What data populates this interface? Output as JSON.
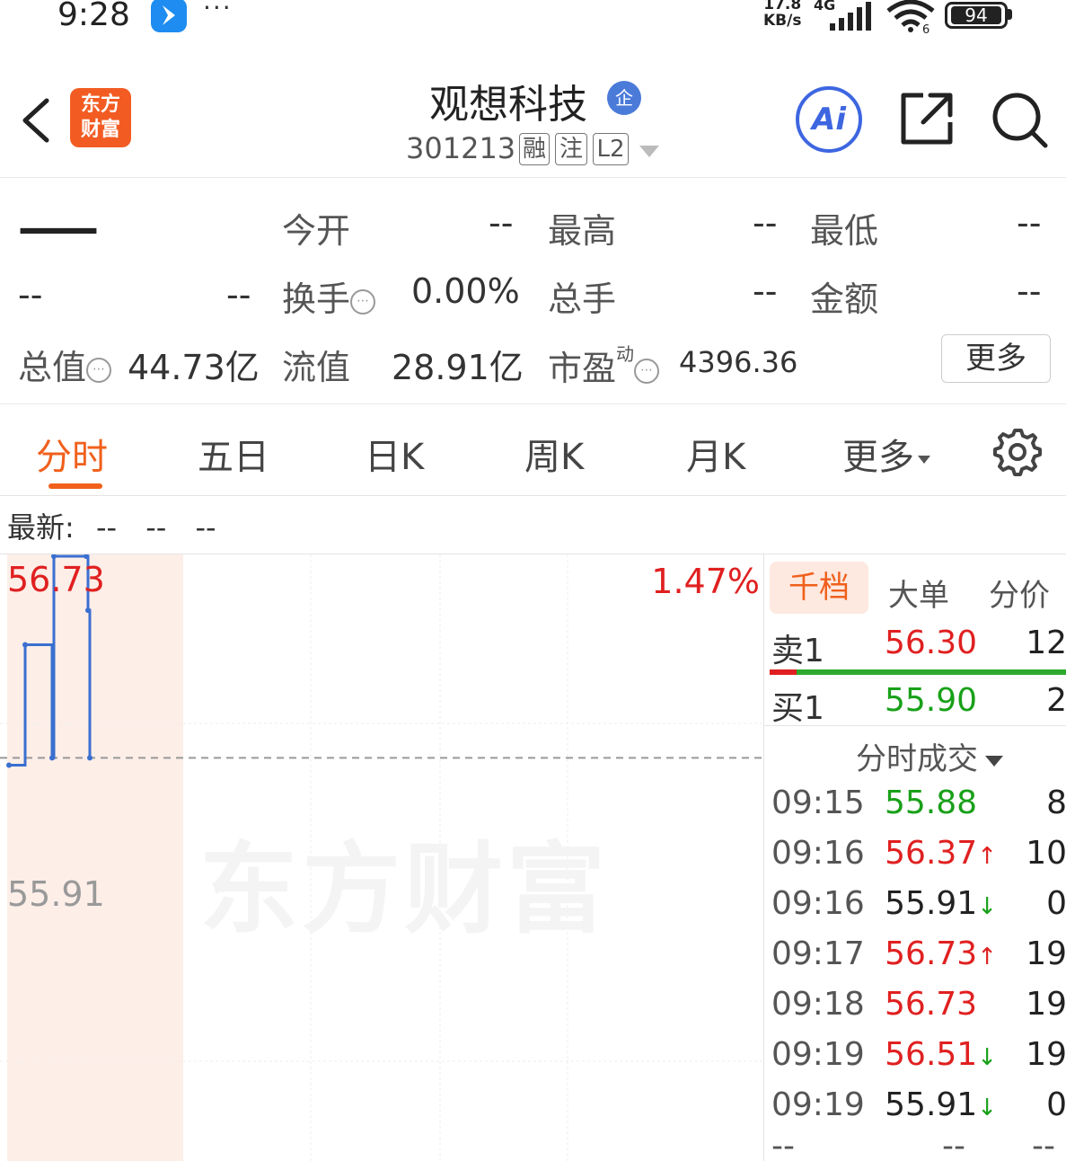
{
  "status_bar": {
    "time": "9:28",
    "dots": "···",
    "net_speed_value": "17.8",
    "net_speed_unit": "KB/s",
    "network": "4G",
    "wifi_badge": "6",
    "battery": "94"
  },
  "header": {
    "logo_line1": "东方",
    "logo_line2": "财富",
    "stock_name": "观想科技",
    "qi_badge": "企",
    "stock_code": "301213",
    "tags": [
      "融",
      "注",
      "L2"
    ],
    "ai_label": "Ai"
  },
  "quote": {
    "price": "——",
    "change": "--",
    "change_pct": "--",
    "open_label": "今开",
    "open_value": "--",
    "high_label": "最高",
    "high_value": "--",
    "low_label": "最低",
    "low_value": "--",
    "turnover_label": "换手",
    "turnover_value": "0.00%",
    "volume_label": "总手",
    "volume_value": "--",
    "amount_label": "金额",
    "amount_value": "--",
    "mktcap_label": "总值",
    "mktcap_value": "44.73亿",
    "float_label": "流值",
    "float_value": "28.91亿",
    "pe_label": "市盈",
    "pe_super": "动",
    "pe_value": "4396.36",
    "more_label": "更多",
    "info_glyph": "⋯"
  },
  "tabs": {
    "items": [
      "分时",
      "五日",
      "日K",
      "周K",
      "月K",
      "更多"
    ],
    "active": "分时"
  },
  "latest": {
    "label": "最新:",
    "values": [
      "--",
      "--",
      "--"
    ]
  },
  "chart_data": {
    "type": "line",
    "ylabel_high": "56.73",
    "ylabel_base": "55.91",
    "pct_high": "1.47%",
    "ylim": [
      55.09,
      56.73
    ],
    "base_price": 55.91,
    "x": [
      "09:15",
      "09:16",
      "09:16",
      "09:17",
      "09:18",
      "09:19",
      "09:19"
    ],
    "series": [
      {
        "values": [
          55.88,
          56.37,
          55.91,
          56.73,
          56.73,
          56.51,
          55.91
        ]
      }
    ],
    "watermark": "东方财富",
    "colors": {
      "line": "#3a6fd0",
      "auction_bg": "#fdeee8",
      "base_line": "#999999"
    }
  },
  "right_panel": {
    "tabs": [
      "千档",
      "大单",
      "分价"
    ],
    "active_tab": "千档",
    "orderbook": [
      {
        "label": "卖1",
        "price": "56.30",
        "vol": "12",
        "color": "red"
      },
      {
        "label": "买1",
        "price": "55.90",
        "vol": "2",
        "color": "green"
      }
    ],
    "trades_title": "分时成交",
    "trades": [
      {
        "time": "09:15",
        "price": "55.88",
        "arrow": "",
        "vol": "8",
        "color": "green"
      },
      {
        "time": "09:16",
        "price": "56.37",
        "arrow": "↑",
        "vol": "10",
        "color": "red"
      },
      {
        "time": "09:16",
        "price": "55.91",
        "arrow": "↓",
        "vol": "0",
        "color": "black"
      },
      {
        "time": "09:17",
        "price": "56.73",
        "arrow": "↑",
        "vol": "19",
        "color": "red"
      },
      {
        "time": "09:18",
        "price": "56.73",
        "arrow": "",
        "vol": "19",
        "color": "red"
      },
      {
        "time": "09:19",
        "price": "56.51",
        "arrow": "↓",
        "vol": "19",
        "color": "red"
      },
      {
        "time": "09:19",
        "price": "55.91",
        "arrow": "↓",
        "vol": "0",
        "color": "black"
      }
    ],
    "trailing": [
      "--",
      "--",
      "--"
    ]
  }
}
